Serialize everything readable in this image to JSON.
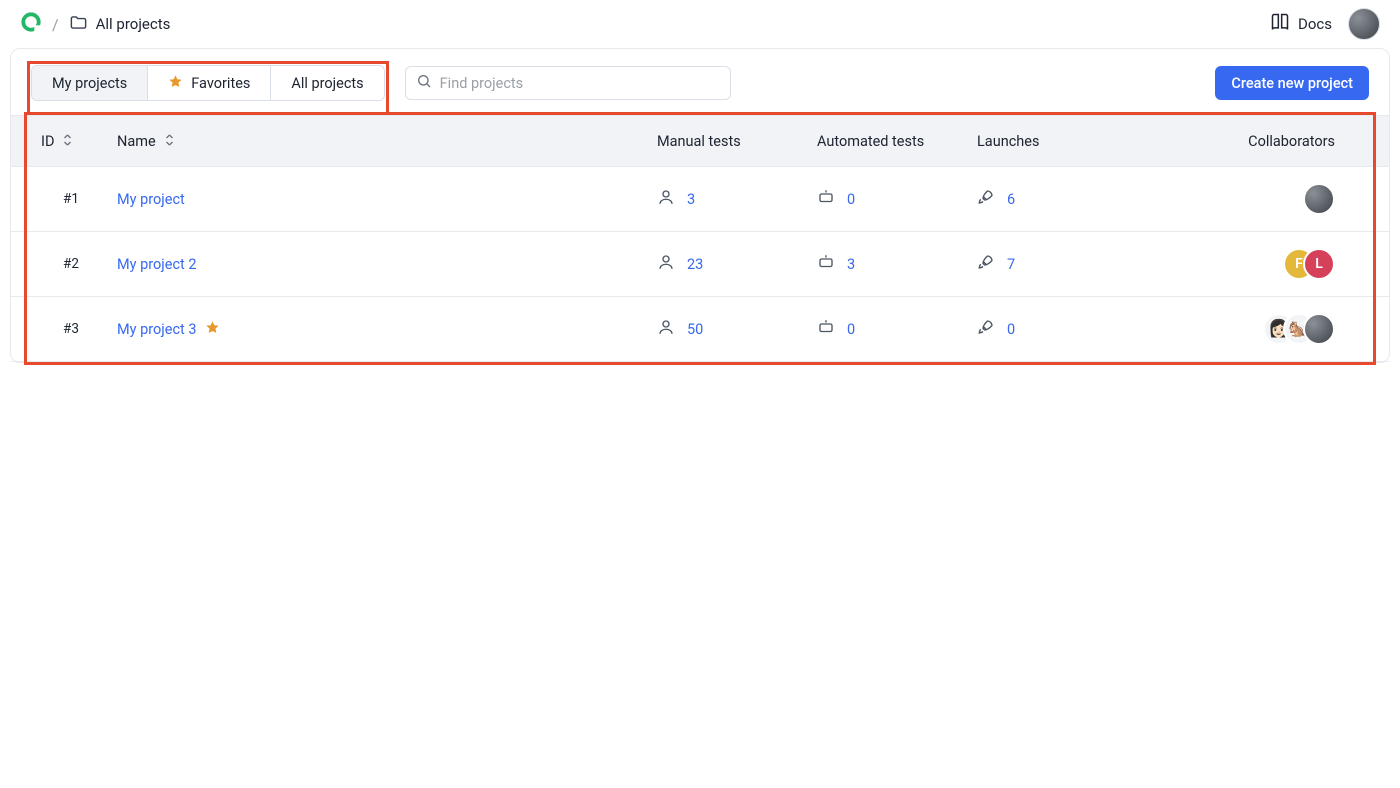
{
  "header": {
    "breadcrumb": "All projects",
    "docs_label": "Docs"
  },
  "tabs": {
    "my_projects": "My projects",
    "favorites": "Favorites",
    "all_projects": "All projects",
    "active": "my_projects"
  },
  "search": {
    "placeholder": "Find projects"
  },
  "actions": {
    "create_project": "Create new project"
  },
  "table": {
    "columns": {
      "id": "ID",
      "name": "Name",
      "manual_tests": "Manual tests",
      "automated_tests": "Automated tests",
      "launches": "Launches",
      "collaborators": "Collaborators"
    },
    "rows": [
      {
        "id": "#1",
        "name": "My project",
        "favorite": false,
        "manual_tests": "3",
        "automated_tests": "0",
        "launches": "6",
        "collaborators": [
          {
            "type": "grad"
          }
        ]
      },
      {
        "id": "#2",
        "name": "My project 2",
        "favorite": false,
        "manual_tests": "23",
        "automated_tests": "3",
        "launches": "7",
        "collaborators": [
          {
            "type": "letter",
            "letter": "F",
            "color": "#e4b93b"
          },
          {
            "type": "letter",
            "letter": "L",
            "color": "#d6415a"
          }
        ]
      },
      {
        "id": "#3",
        "name": "My project 3",
        "favorite": true,
        "manual_tests": "50",
        "automated_tests": "0",
        "launches": "0",
        "collaborators": [
          {
            "type": "emoji",
            "emoji": "👩🏻"
          },
          {
            "type": "emoji",
            "emoji": "🐿️"
          },
          {
            "type": "grad"
          }
        ]
      }
    ]
  }
}
